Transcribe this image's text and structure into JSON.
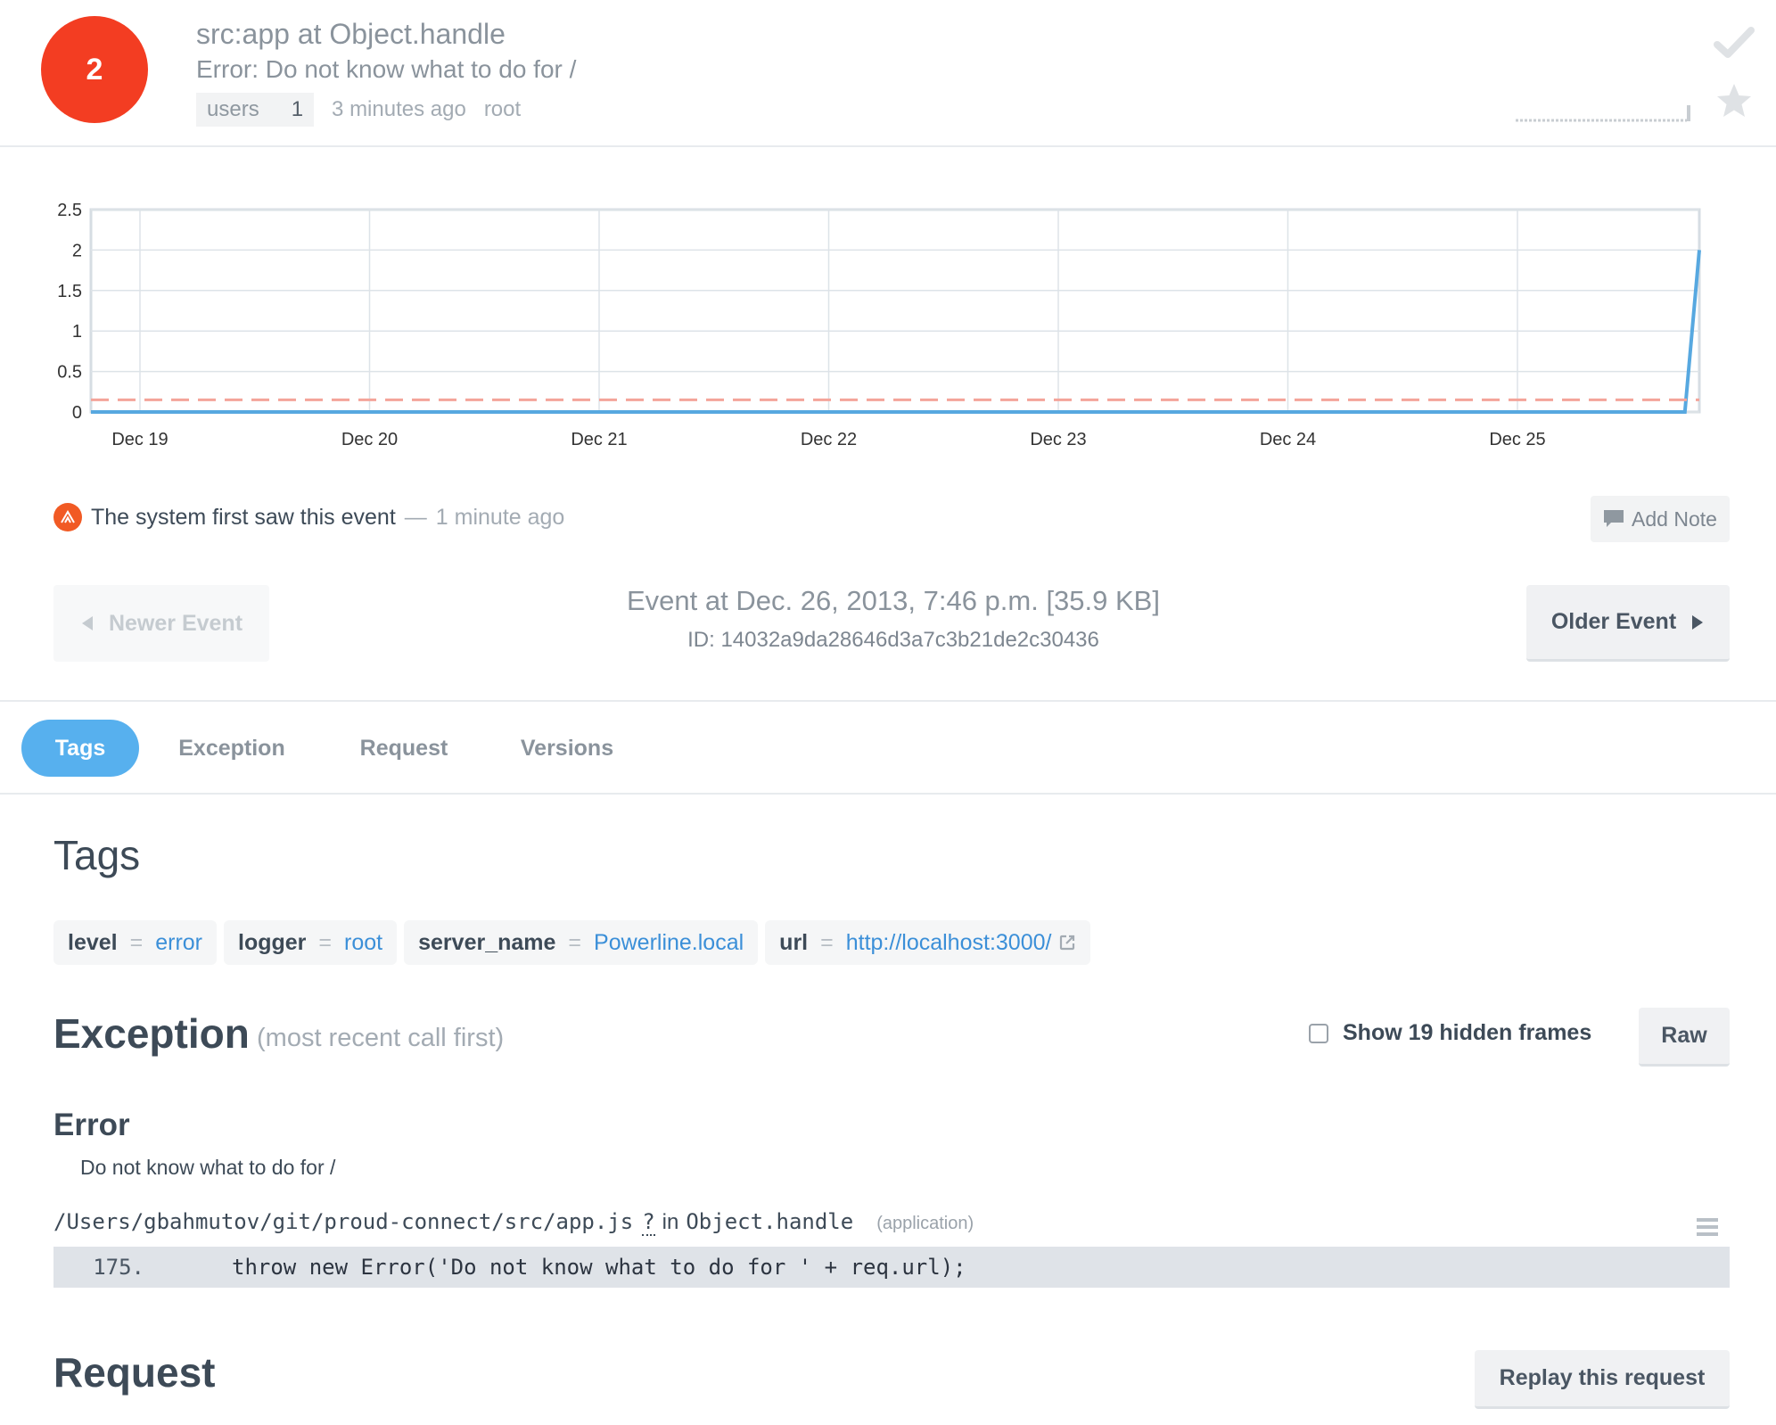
{
  "header": {
    "count": "2",
    "title": "src:app at Object.handle",
    "message": "Error: Do not know what to do for /",
    "users_label": "users",
    "users_count": "1",
    "time_ago": "3 minutes ago",
    "logger": "root"
  },
  "chart_data": {
    "type": "line",
    "x": [
      "Dec 19",
      "Dec 20",
      "Dec 21",
      "Dec 22",
      "Dec 23",
      "Dec 24",
      "Dec 25"
    ],
    "ylim": [
      0,
      2.5
    ],
    "y_ticks": [
      "2.5",
      "2",
      "1.5",
      "1",
      "0.5",
      "0"
    ],
    "series": [
      {
        "points": [
          [
            0,
            0
          ],
          [
            0.991,
            0
          ],
          [
            1.0,
            2
          ]
        ],
        "color": "#57a8e0"
      },
      {
        "points": [
          [
            0,
            0.15
          ],
          [
            1.0,
            0.15
          ]
        ],
        "color": "#f4a49a",
        "dashed": true
      }
    ],
    "grid": true
  },
  "activity": {
    "text": "The system first saw this event",
    "dash": "—",
    "time": "1 minute ago",
    "add_note": "Add Note"
  },
  "event": {
    "newer": "Newer Event",
    "older": "Older Event",
    "title": "Event at Dec. 26, 2013, 7:46 p.m. [35.9 KB]",
    "id": "ID: 14032a9da28646d3a7c3b21de2c30436"
  },
  "tabs": [
    {
      "label": "Tags"
    },
    {
      "label": "Exception"
    },
    {
      "label": "Request"
    },
    {
      "label": "Versions"
    }
  ],
  "tags": {
    "heading": "Tags",
    "items": [
      {
        "key": "level",
        "eq": "=",
        "value": "error"
      },
      {
        "key": "logger",
        "eq": "=",
        "value": "root"
      },
      {
        "key": "server_name",
        "eq": "=",
        "value": "Powerline.local"
      },
      {
        "key": "url",
        "eq": "=",
        "value": "http://localhost:3000/"
      }
    ]
  },
  "exception": {
    "heading": "Exception",
    "subheading": "(most recent call first)",
    "show_hidden": "Show 19 hidden frames",
    "raw": "Raw",
    "type": "Error",
    "value": "Do not know what to do for /",
    "frame": {
      "path": "/Users/gbahmutov/git/proud-connect/src/app.js",
      "q": "?",
      "in": "in",
      "func": "Object.handle",
      "context": "(application)",
      "line_no": "175.",
      "code": "throw new Error('Do not know what to do for ' + req.url);"
    }
  },
  "request": {
    "heading": "Request",
    "replay": "Replay this request"
  }
}
